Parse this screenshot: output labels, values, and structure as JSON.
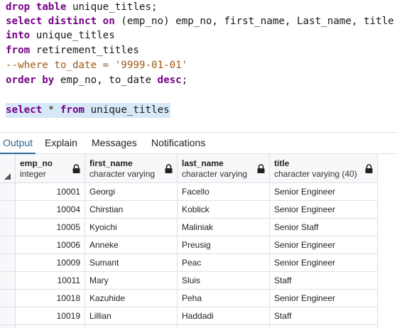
{
  "editor": {
    "lines": [
      [
        {
          "t": "drop table ",
          "c": "kw"
        },
        {
          "t": "unique_titles;",
          "c": ""
        }
      ],
      [
        {
          "t": "select distinct on",
          "c": "kw"
        },
        {
          "t": " (emp_no) emp_no, first_name, Last_name, title",
          "c": ""
        }
      ],
      [
        {
          "t": "into ",
          "c": "kw"
        },
        {
          "t": "unique_titles",
          "c": ""
        }
      ],
      [
        {
          "t": "from ",
          "c": "kw"
        },
        {
          "t": "retirement_titles",
          "c": ""
        }
      ],
      [
        {
          "t": "--where to_date = '9999-01-01'",
          "c": "cm"
        }
      ],
      [
        {
          "t": "order by ",
          "c": "kw"
        },
        {
          "t": "emp_no, to_date ",
          "c": ""
        },
        {
          "t": "desc",
          "c": "kw"
        },
        {
          "t": ";",
          "c": ""
        }
      ],
      [],
      [
        {
          "t": "select ",
          "c": "kw"
        },
        {
          "t": "* ",
          "c": ""
        },
        {
          "t": "from ",
          "c": "kw"
        },
        {
          "t": "unique_titles",
          "c": ""
        }
      ]
    ]
  },
  "tabs": [
    {
      "label": "Output",
      "active": true
    },
    {
      "label": "Explain",
      "active": false
    },
    {
      "label": "Messages",
      "active": false
    },
    {
      "label": "Notifications",
      "active": false
    }
  ],
  "columns": [
    {
      "name": "emp_no",
      "type": "integer"
    },
    {
      "name": "first_name",
      "type": "character varying"
    },
    {
      "name": "last_name",
      "type": "character varying"
    },
    {
      "name": "title",
      "type": "character varying (40)"
    }
  ],
  "rows": [
    [
      "10001",
      "Georgi",
      "Facello",
      "Senior Engineer"
    ],
    [
      "10004",
      "Chirstian",
      "Koblick",
      "Senior Engineer"
    ],
    [
      "10005",
      "Kyoichi",
      "Maliniak",
      "Senior Staff"
    ],
    [
      "10006",
      "Anneke",
      "Preusig",
      "Senior Engineer"
    ],
    [
      "10009",
      "Sumant",
      "Peac",
      "Senior Engineer"
    ],
    [
      "10011",
      "Mary",
      "Sluis",
      "Staff"
    ],
    [
      "10018",
      "Kazuhide",
      "Peha",
      "Senior Engineer"
    ],
    [
      "10019",
      "Lillian",
      "Haddadi",
      "Staff"
    ],
    [
      "",
      "",
      "",
      ""
    ]
  ],
  "colors": {
    "keyword": "#770088",
    "comment": "#a05a14",
    "active_tab": "#326690",
    "selection": "#d7e8f7"
  }
}
